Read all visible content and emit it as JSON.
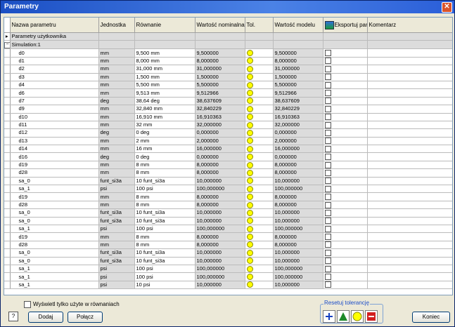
{
  "window": {
    "title": "Parametry"
  },
  "columns": [
    "Nazwa parametru",
    "Jednostka",
    "Równanie",
    "Wartość nominalna",
    "Tol.",
    "Wartość modelu",
    "Eksportuj par",
    "Komentarz"
  ],
  "group_user": "Parametry użytkownika",
  "group_sim": "Simulation:1",
  "rows": [
    [
      "d0",
      "mm",
      "9,500 mm",
      "9,500000",
      "9,500000"
    ],
    [
      "d1",
      "mm",
      "8,000 mm",
      "8,000000",
      "8,000000"
    ],
    [
      "d2",
      "mm",
      "31,000 mm",
      "31,000000",
      "31,000000"
    ],
    [
      "d3",
      "mm",
      "1,500 mm",
      "1,500000",
      "1,500000"
    ],
    [
      "d4",
      "mm",
      "5,500 mm",
      "5,500000",
      "5,500000"
    ],
    [
      "d6",
      "mm",
      "9,513 mm",
      "9,512966",
      "9,512966"
    ],
    [
      "d7",
      "deg",
      "38,64 deg",
      "38,637609",
      "38,637609"
    ],
    [
      "d9",
      "mm",
      "32,840 mm",
      "32,840229",
      "32,840229"
    ],
    [
      "d10",
      "mm",
      "16,910 mm",
      "16,910363",
      "16,910363"
    ],
    [
      "d11",
      "mm",
      "32 mm",
      "32,000000",
      "32,000000"
    ],
    [
      "d12",
      "deg",
      "0 deg",
      "0,000000",
      "0,000000"
    ],
    [
      "d13",
      "mm",
      "2 mm",
      "2,000000",
      "2,000000"
    ],
    [
      "d14",
      "mm",
      "16 mm",
      "16,000000",
      "16,000000"
    ],
    [
      "d16",
      "deg",
      "0 deg",
      "0,000000",
      "0,000000"
    ],
    [
      "d19",
      "mm",
      "8 mm",
      "8,000000",
      "8,000000"
    ],
    [
      "d28",
      "mm",
      "8 mm",
      "8,000000",
      "8,000000"
    ],
    [
      "sa_0",
      "funt_si3a",
      "10 funt_si3a",
      "10,000000",
      "10,000000"
    ],
    [
      "sa_1",
      "psi",
      "100 psi",
      "100,000000",
      "100,000000"
    ],
    [
      "d19",
      "mm",
      "8 mm",
      "8,000000",
      "8,000000"
    ],
    [
      "d28",
      "mm",
      "8 mm",
      "8,000000",
      "8,000000"
    ],
    [
      "sa_0",
      "funt_si3a",
      "10 funt_si3a",
      "10,000000",
      "10,000000"
    ],
    [
      "sa_0",
      "funt_si3a",
      "10 funt_si3a",
      "10,000000",
      "10,000000"
    ],
    [
      "sa_1",
      "psi",
      "100 psi",
      "100,000000",
      "100,000000"
    ],
    [
      "d19",
      "mm",
      "8 mm",
      "8,000000",
      "8,000000"
    ],
    [
      "d28",
      "mm",
      "8 mm",
      "8,000000",
      "8,000000"
    ],
    [
      "sa_0",
      "funt_si3a",
      "10 funt_si3a",
      "10,000000",
      "10,000000"
    ],
    [
      "sa_0",
      "funt_si3a",
      "10 funt_si3a",
      "10,000000",
      "10,000000"
    ],
    [
      "sa_1",
      "psi",
      "100 psi",
      "100,000000",
      "100,000000"
    ],
    [
      "sa_1",
      "psi",
      "100 psi",
      "100,000000",
      "100,000000"
    ],
    [
      "sa_1",
      "psi",
      "10 psi",
      "10,000000",
      "10,000000"
    ]
  ],
  "footer": {
    "only_used_label": "Wyświetl tylko użyte w równaniach",
    "add_label": "Dodaj",
    "link_label": "Połącz",
    "reset_tol_label": "Resetuj tolerancję",
    "close_label": "Koniec",
    "help_label": "?"
  },
  "colors": {
    "tol_indicator": "#ffff00",
    "title_bar": "#1b4fc4"
  }
}
